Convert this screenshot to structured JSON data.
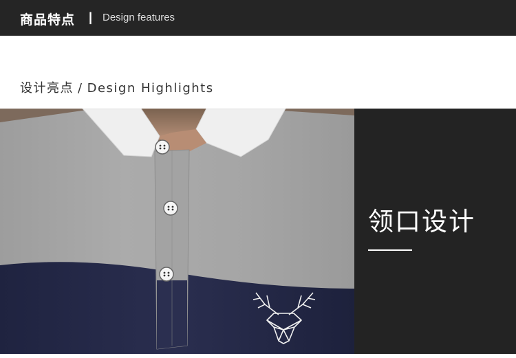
{
  "header": {
    "title_cn": "商品特点",
    "separator": "|",
    "title_en": "Design features"
  },
  "section": {
    "title_cn": "设计亮点",
    "separator": "/",
    "title_en": "Design Highlights"
  },
  "detail": {
    "label_cn": "领口设计"
  },
  "colors": {
    "header_bg": "#252525",
    "side_panel_bg": "#232323",
    "shirt_grey": "#a7a7a7",
    "shirt_navy": "#262a4a",
    "collar_white": "#efefef"
  },
  "icons": [
    "deer-head-logo-icon",
    "button-icon"
  ]
}
